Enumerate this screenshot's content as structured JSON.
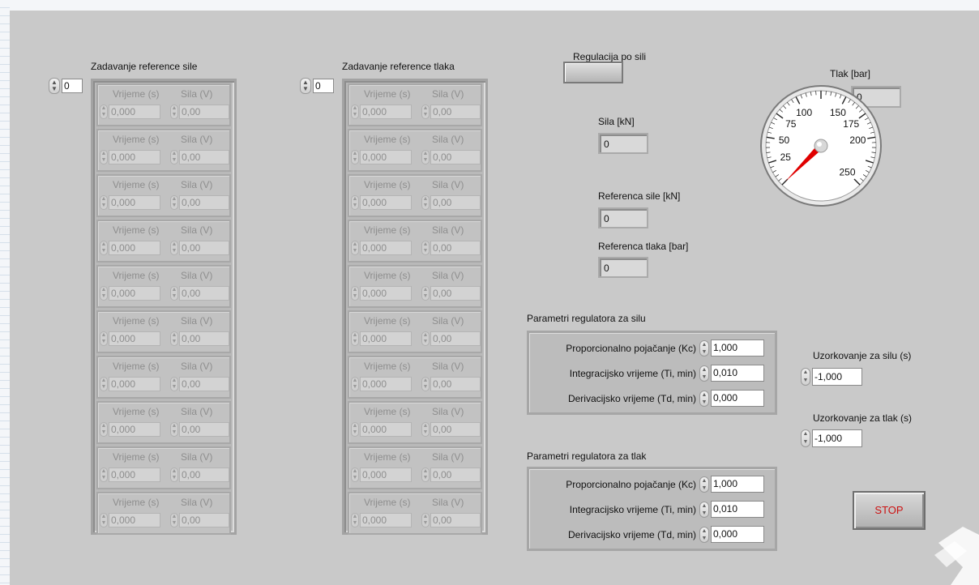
{
  "array_sile": {
    "title": "Zadavanje reference sile",
    "index": "0",
    "rows": [
      {
        "h1": "Vrijeme (s)",
        "h2": "Sila (V)",
        "t": "0,000",
        "s": "0,00"
      },
      {
        "h1": "Vrijeme (s)",
        "h2": "Sila (V)",
        "t": "0,000",
        "s": "0,00"
      },
      {
        "h1": "Vrijeme (s)",
        "h2": "Sila (V)",
        "t": "0,000",
        "s": "0,00"
      },
      {
        "h1": "Vrijeme (s)",
        "h2": "Sila (V)",
        "t": "0,000",
        "s": "0,00"
      },
      {
        "h1": "Vrijeme (s)",
        "h2": "Sila (V)",
        "t": "0,000",
        "s": "0,00"
      },
      {
        "h1": "Vrijeme (s)",
        "h2": "Sila (V)",
        "t": "0,000",
        "s": "0,00"
      },
      {
        "h1": "Vrijeme (s)",
        "h2": "Sila (V)",
        "t": "0,000",
        "s": "0,00"
      },
      {
        "h1": "Vrijeme (s)",
        "h2": "Sila (V)",
        "t": "0,000",
        "s": "0,00"
      },
      {
        "h1": "Vrijeme (s)",
        "h2": "Sila (V)",
        "t": "0,000",
        "s": "0,00"
      },
      {
        "h1": "Vrijeme (s)",
        "h2": "Sila (V)",
        "t": "0,000",
        "s": "0,00"
      }
    ]
  },
  "array_tlaka": {
    "title": "Zadavanje reference tlaka",
    "index": "0",
    "rows": [
      {
        "h1": "Vrijeme (s)",
        "h2": "Sila (V)",
        "t": "0,000",
        "s": "0,00"
      },
      {
        "h1": "Vrijeme (s)",
        "h2": "Sila (V)",
        "t": "0,000",
        "s": "0,00"
      },
      {
        "h1": "Vrijeme (s)",
        "h2": "Sila (V)",
        "t": "0,000",
        "s": "0,00"
      },
      {
        "h1": "Vrijeme (s)",
        "h2": "Sila (V)",
        "t": "0,000",
        "s": "0,00"
      },
      {
        "h1": "Vrijeme (s)",
        "h2": "Sila (V)",
        "t": "0,000",
        "s": "0,00"
      },
      {
        "h1": "Vrijeme (s)",
        "h2": "Sila (V)",
        "t": "0,000",
        "s": "0,00"
      },
      {
        "h1": "Vrijeme (s)",
        "h2": "Sila (V)",
        "t": "0,000",
        "s": "0,00"
      },
      {
        "h1": "Vrijeme (s)",
        "h2": "Sila (V)",
        "t": "0,000",
        "s": "0,00"
      },
      {
        "h1": "Vrijeme (s)",
        "h2": "Sila (V)",
        "t": "0,000",
        "s": "0,00"
      },
      {
        "h1": "Vrijeme (s)",
        "h2": "Sila (V)",
        "t": "0,000",
        "s": "0,00"
      }
    ]
  },
  "regulacija": {
    "label": "Regulacija po sili"
  },
  "sila": {
    "label": "Sila [kN]",
    "value": "0"
  },
  "referenca_sile": {
    "label": "Referenca sile [kN]",
    "value": "0"
  },
  "referenca_tlaka": {
    "label": "Referenca tlaka [bar]",
    "value": "0"
  },
  "gauge": {
    "label": "Tlak [bar]",
    "value": "0",
    "needle_value": 0,
    "min": 0,
    "max": 250,
    "ticks": [
      "25",
      "50",
      "75",
      "100",
      "150",
      "175",
      "200",
      "250"
    ]
  },
  "pid_sila": {
    "title": "Parametri regulatora za silu",
    "kc_label": "Proporcionalno pojačanje (Kc)",
    "kc": "1,000",
    "ti_label": "Integracijsko vrijeme (Ti, min)",
    "ti": "0,010",
    "td_label": "Derivacijsko vrijeme (Td, min)",
    "td": "0,000"
  },
  "pid_tlak": {
    "title": "Parametri regulatora za tlak",
    "kc_label": "Proporcionalno pojačanje (Kc)",
    "kc": "1,000",
    "ti_label": "Integracijsko vrijeme (Ti, min)",
    "ti": "0,010",
    "td_label": "Derivacijsko vrijeme (Td, min)",
    "td": "0,000"
  },
  "uzork_sila": {
    "label": "Uzorkovanje za silu (s)",
    "value": "-1,000"
  },
  "uzork_tlak": {
    "label": "Uzorkovanje za tlak (s)",
    "value": "-1,000"
  },
  "stop": {
    "label": "STOP"
  },
  "colors": {
    "panel": "#c9c9c9",
    "needle": "#e00000",
    "stop_text": "#cc1111"
  }
}
